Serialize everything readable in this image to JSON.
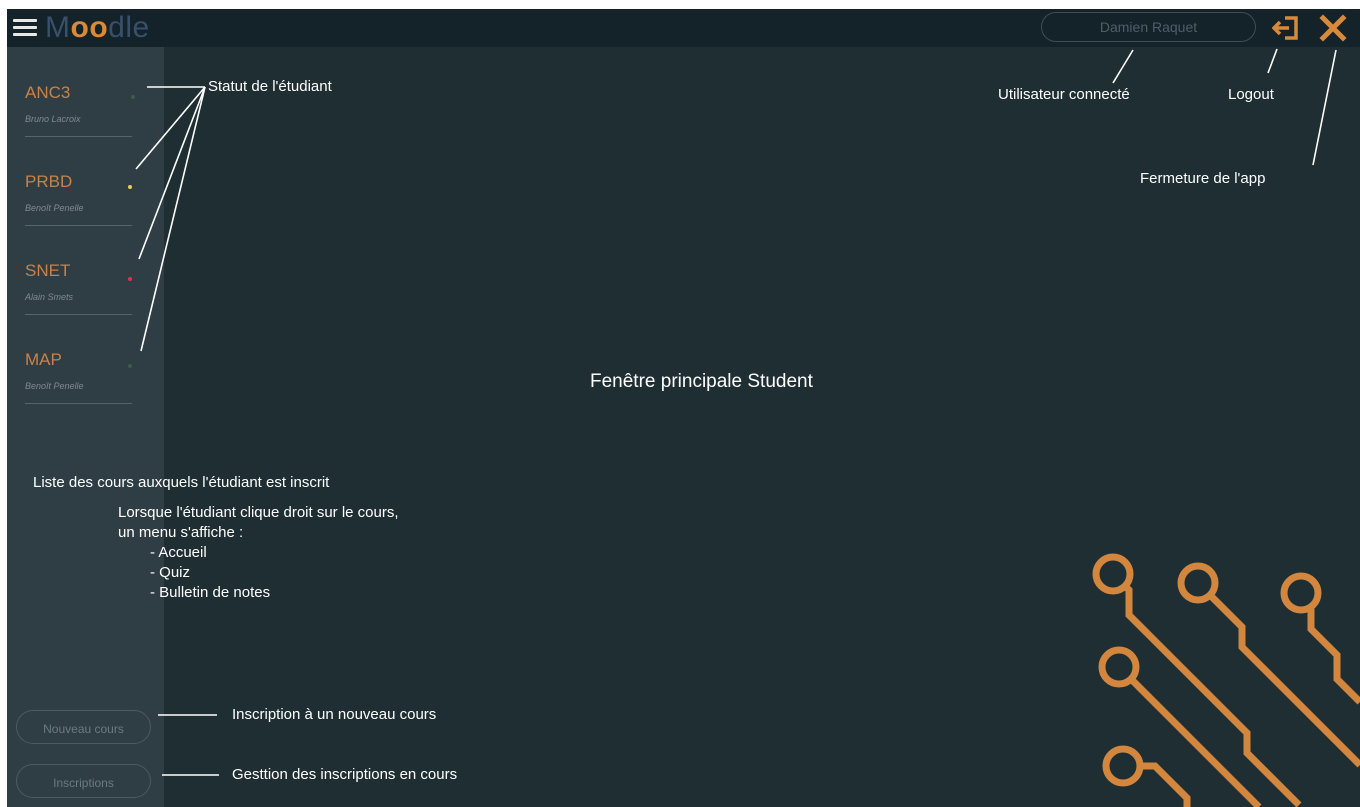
{
  "app": {
    "brand_parts": [
      "M",
      "oo",
      "dle"
    ],
    "user_name": "Damien Raquet",
    "accent": "#d88a3a"
  },
  "topbar_icons": {
    "menu": "hamburger-icon",
    "logout": "logout-arrow-icon",
    "close": "close-x-icon"
  },
  "courses": [
    {
      "code": "ANC3",
      "teacher": "Bruno Lacroix",
      "status_color": "#3a5c4c"
    },
    {
      "code": "PRBD",
      "teacher": "Benoît Penelle",
      "status_color": "#e7d24a"
    },
    {
      "code": "SNET",
      "teacher": "Alain Smets",
      "status_color": "#d8374a"
    },
    {
      "code": "MAP",
      "teacher": "Benoît Penelle",
      "status_color": "#3a5c4c"
    }
  ],
  "buttons": {
    "new_course": "Nouveau cours",
    "registrations": "Inscriptions"
  },
  "annotations": {
    "student_status": "Statut de l'étudiant",
    "logged_user": "Utilisateur connecté",
    "logout": "Logout",
    "close_app": "Fermeture de l'app",
    "main_window": "Fenêtre principale Student",
    "course_list": "Liste des cours auxquels l'étudiant est inscrit",
    "context_menu_line1": "Lorsque l'étudiant clique droit sur le cours,",
    "context_menu_line2": "un menu s'affiche :",
    "menu_items": [
      "- Accueil",
      "- Quiz",
      "- Bulletin de notes"
    ],
    "new_course": "Inscription à un nouveau cours",
    "manage_registrations": "Gesttion des inscriptions en cours"
  }
}
